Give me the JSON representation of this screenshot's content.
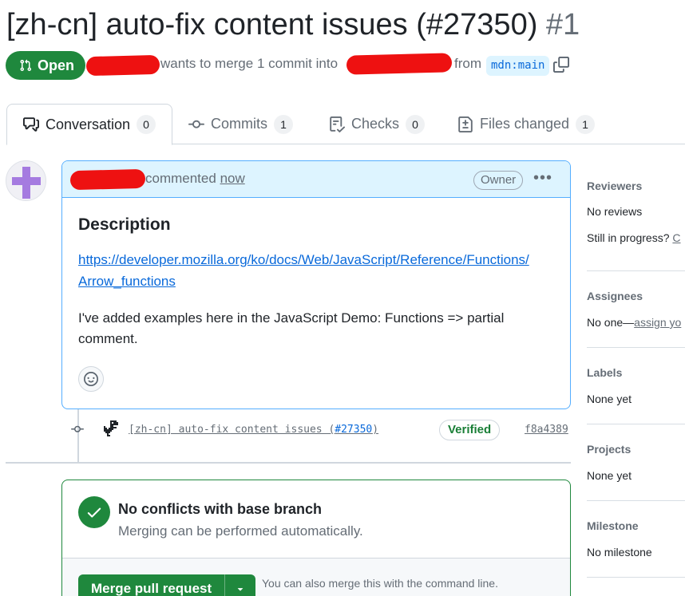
{
  "pr": {
    "title": "[zh-cn] auto-fix content issues (#27350)",
    "number": "#1",
    "state": "Open",
    "meta_wants": "wants to merge 1 commit into",
    "meta_from": "from",
    "head_branch": "mdn:main"
  },
  "tabs": [
    {
      "label": "Conversation",
      "count": "0",
      "icon": "comment-discussion-icon"
    },
    {
      "label": "Commits",
      "count": "1",
      "icon": "git-commit-icon"
    },
    {
      "label": "Checks",
      "count": "0",
      "icon": "checklist-icon"
    },
    {
      "label": "Files changed",
      "count": "1",
      "icon": "file-diff-icon"
    }
  ],
  "comment": {
    "action": "commented",
    "time": "now",
    "role": "Owner",
    "heading": "Description",
    "link_line1": "https://developer.mozilla.org/ko/docs/Web/JavaScript/Reference/Functions/",
    "link_line2": "Arrow_functions",
    "body": "I've added examples here in the JavaScript Demo: Functions => partial comment."
  },
  "commit": {
    "message_prefix": "[zh-cn] auto-fix content issues (",
    "pr_ref": "#27350",
    "message_suffix": ")",
    "verified": "Verified",
    "sha": "f8a4389"
  },
  "merge": {
    "heading": "No conflicts with base branch",
    "subtext": "Merging can be performed automatically.",
    "button": "Merge pull request",
    "hint": "You can also merge this with the command line."
  },
  "sidebar": {
    "reviewers_title": "Reviewers",
    "reviewers_value": "No reviews",
    "reviewers_progress": "Still in progress?",
    "reviewers_progress_link": "C",
    "assignees_title": "Assignees",
    "assignees_value": "No one—",
    "assignees_link": "assign yo",
    "labels_title": "Labels",
    "labels_value": "None yet",
    "projects_title": "Projects",
    "projects_value": "None yet",
    "milestone_title": "Milestone",
    "milestone_value": "No milestone"
  },
  "colors": {
    "open_green": "#1f883d",
    "link_blue": "#0969da",
    "comment_header_bg": "#ddf4ff",
    "redaction_red": "#ee1111"
  }
}
